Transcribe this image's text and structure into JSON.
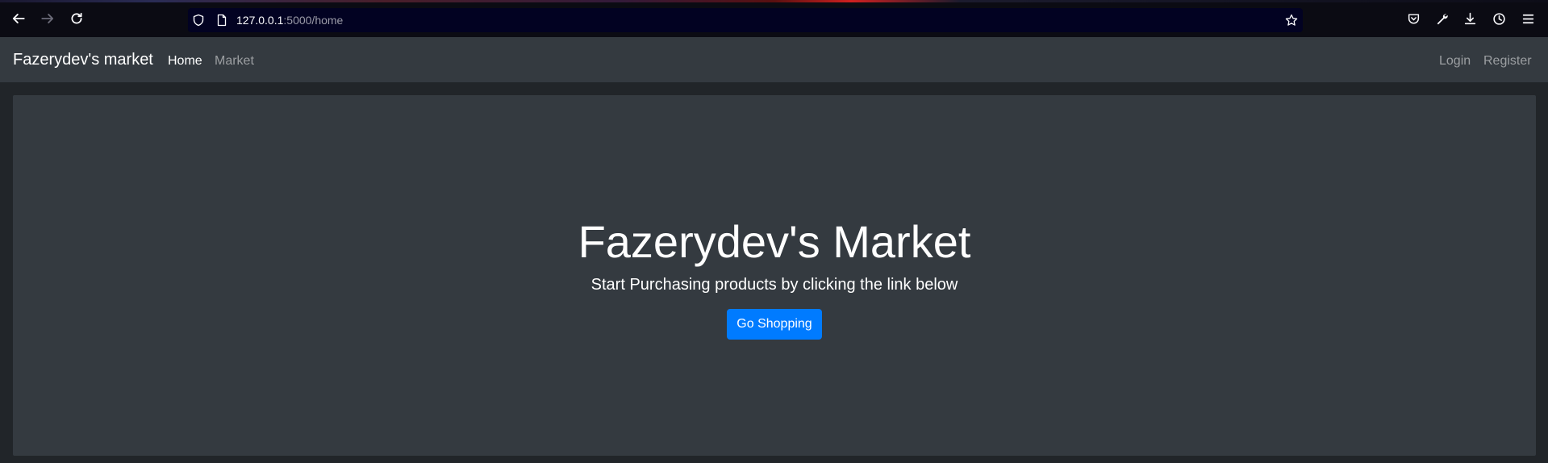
{
  "browser": {
    "url_host": "127.0.0.1",
    "url_rest": ":5000/home",
    "icons": [
      "back-arrow-icon",
      "forward-arrow-icon",
      "reload-icon",
      "shield-icon",
      "page-icon",
      "star-icon",
      "pocket-icon",
      "wrench-icon",
      "download-icon",
      "history-icon",
      "menu-icon"
    ]
  },
  "navbar": {
    "brand": "Fazerydev's market",
    "links": [
      {
        "label": "Home",
        "active": true
      },
      {
        "label": "Market",
        "active": false
      }
    ],
    "right_links": [
      {
        "label": "Login"
      },
      {
        "label": "Register"
      }
    ]
  },
  "hero": {
    "title": "Fazerydev's Market",
    "subtitle": "Start Purchasing products by clicking the link below",
    "button_label": "Go Shopping"
  },
  "colors": {
    "page_bg": "#212529",
    "navbar_bg": "#343a40",
    "primary": "#007bff"
  }
}
